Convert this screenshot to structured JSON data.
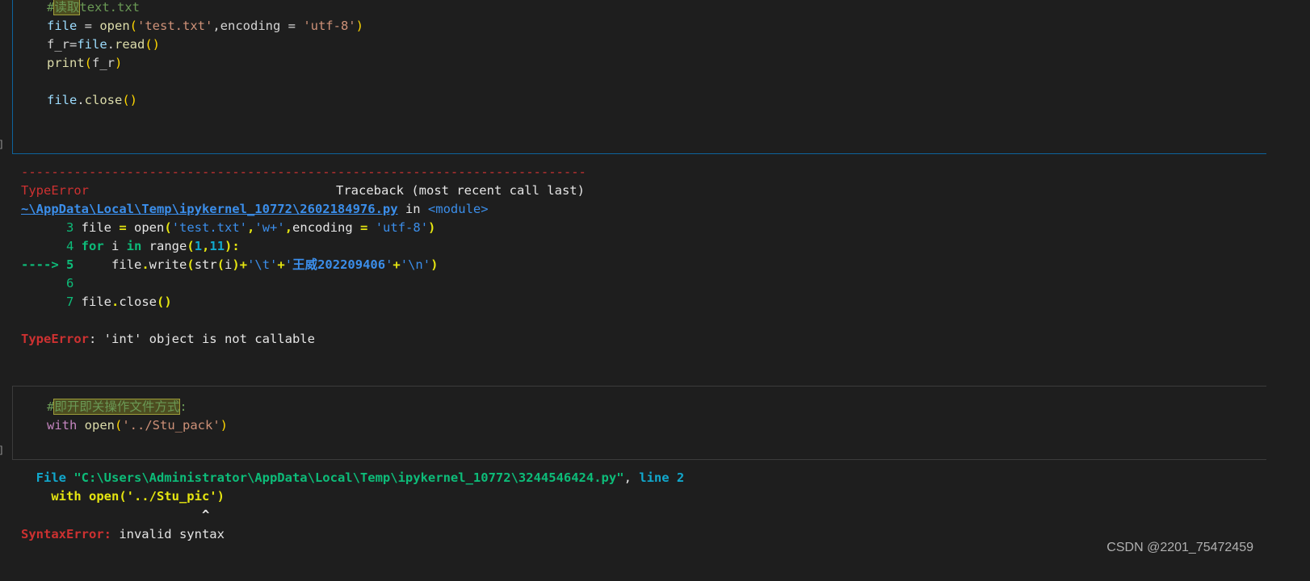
{
  "cell1": {
    "bracket": "]",
    "lines": {
      "l1_hash": "#",
      "l1_cjk": "读取",
      "l1_rest": "text.txt",
      "l2_file": "file",
      "l2_eq": " = ",
      "l2_open": "open",
      "l2_p1": "(",
      "l2_s1": "'test.txt'",
      "l2_mid": ",encoding = ",
      "l2_s2": "'utf-8'",
      "l2_p2": ")",
      "l3_a": "f_r=",
      "l3_file": "file",
      "l3_dot": ".",
      "l3_read": "read",
      "l3_p": "()",
      "l4_print": "print",
      "l4_p1": "(",
      "l4_arg": "f_r",
      "l4_p2": ")",
      "l6_file": "file",
      "l6_dot": ".",
      "l6_close": "close",
      "l6_p": "()"
    }
  },
  "output1": {
    "dashes": "---------------------------------------------------------------------------",
    "error_type": "TypeError",
    "traceback_header": "Traceback (most recent call last)",
    "path": "~\\AppData\\Local\\Temp\\ipykernel_10772\\2602184976.py",
    "in_text": " in ",
    "module": "<module>",
    "tb_l3_no": "      3",
    "tb_l3_a": " file ",
    "tb_l3_eq": "=",
    "tb_l3_b": " open",
    "tb_l3_p1": "(",
    "tb_l3_s1": "'test.txt'",
    "tb_l3_c1": ",",
    "tb_l3_s2": "'w+'",
    "tb_l3_c2": ",",
    "tb_l3_enc": "encoding ",
    "tb_l3_eq2": "=",
    "tb_l3_sp": " ",
    "tb_l3_s3": "'utf-8'",
    "tb_l3_p2": ")",
    "tb_l4_no": "      4",
    "tb_l4_sp": " ",
    "tb_l4_for": "for",
    "tb_l4_i": " i ",
    "tb_l4_in": "in",
    "tb_l4_range": " range",
    "tb_l4_p1": "(",
    "tb_l4_n1": "1",
    "tb_l4_c": ",",
    "tb_l4_n2": "11",
    "tb_l4_p2": ")",
    "tb_l4_colon": ":",
    "tb_l5_arrow": "----> 5",
    "tb_l5_a": "     file",
    "tb_l5_dot": ".",
    "tb_l5_write": "write",
    "tb_l5_p1": "(",
    "tb_l5_str": "str",
    "tb_l5_p2": "(",
    "tb_l5_i": "i",
    "tb_l5_p3": ")",
    "tb_l5_plus1": "+",
    "tb_l5_s1": "'\\t'",
    "tb_l5_plus2": "+",
    "tb_l5_s2a": "'",
    "tb_l5_s2b": "王威202209406",
    "tb_l5_s2c": "'",
    "tb_l5_plus3": "+",
    "tb_l5_s3": "'\\n'",
    "tb_l5_p4": ")",
    "tb_l6_no": "      6",
    "tb_l7_no": "      7",
    "tb_l7_a": " file",
    "tb_l7_dot": ".",
    "tb_l7_close": "close",
    "tb_l7_p": "()",
    "final_type": "TypeError",
    "final_msg": ": 'int' object is not callable"
  },
  "cell2": {
    "bracket": "]",
    "l1_hash": "#",
    "l1_cjk": "即开即关操作文件方式",
    "l1_colon": ":",
    "l2_with": "with",
    "l2_sp": " ",
    "l2_open": "open",
    "l2_p1": "(",
    "l2_s": "'../Stu_pack'",
    "l2_p2": ")"
  },
  "output2": {
    "file_kw": "  File ",
    "file_path": "\"C:\\Users\\Administrator\\AppData\\Local\\Temp\\ipykernel_10772\\3244546424.py\"",
    "file_comma": ", ",
    "line_kw": "line 2",
    "code_line": "    with open('../Stu_pic')",
    "caret": "                        ^",
    "err_type": "SyntaxError:",
    "err_msg": " invalid syntax"
  },
  "watermark": "CSDN @2201_75472459"
}
